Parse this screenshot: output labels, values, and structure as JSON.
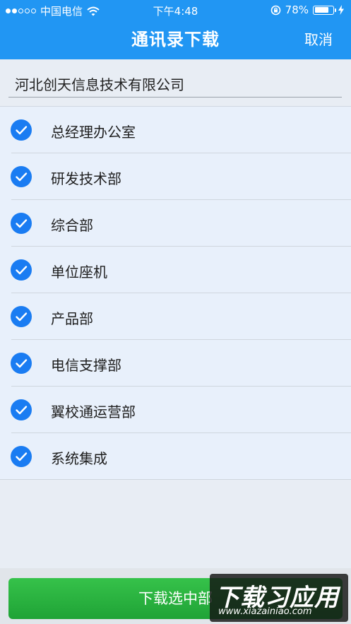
{
  "status_bar": {
    "carrier": "中国电信",
    "time": "下午4:48",
    "battery_percent": "78%",
    "battery_level": 0.78,
    "icons": [
      "signal-dots-icon",
      "wifi-icon",
      "rotation-lock-icon",
      "battery-icon",
      "charging-icon"
    ]
  },
  "nav": {
    "title": "通讯录下载",
    "cancel_label": "取消"
  },
  "company": {
    "name": "河北创天信息技术有限公司"
  },
  "departments": [
    {
      "label": "总经理办公室",
      "checked": true
    },
    {
      "label": "研发技术部",
      "checked": true
    },
    {
      "label": "综合部",
      "checked": true
    },
    {
      "label": "单位座机",
      "checked": true
    },
    {
      "label": "产品部",
      "checked": true
    },
    {
      "label": "电信支撑部",
      "checked": true
    },
    {
      "label": "翼校通运营部",
      "checked": true
    },
    {
      "label": "系统集成",
      "checked": true
    }
  ],
  "footer": {
    "download_label": "下载选中部"
  },
  "watermark": {
    "logo_text": "下载习应用",
    "url": "www.xiazainiao.com"
  },
  "colors": {
    "header": "#2196f3",
    "check": "#1a7cf2",
    "button": "#28b23e",
    "list_background": "#e8f0fb"
  }
}
